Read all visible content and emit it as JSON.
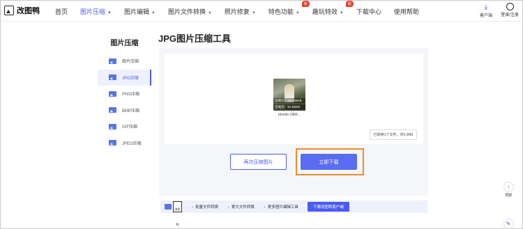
{
  "app": {
    "logo_text": "改图鸭"
  },
  "nav": {
    "items": [
      {
        "label": "首页",
        "chevron": false
      },
      {
        "label": "图片压缩",
        "chevron": true,
        "active": true
      },
      {
        "label": "图片编辑",
        "chevron": true
      },
      {
        "label": "图片文件转换",
        "chevron": true
      },
      {
        "label": "照片修复",
        "chevron": true
      },
      {
        "label": "特色功能",
        "chevron": true,
        "badge": "新"
      },
      {
        "label": "趣玩特效",
        "chevron": true,
        "badge": "新"
      },
      {
        "label": "下载中心",
        "chevron": false
      },
      {
        "label": "使用帮助",
        "chevron": false
      }
    ],
    "client_label": "客户端",
    "login_label": "登录/注册"
  },
  "sidebar": {
    "title": "图片压缩",
    "items": [
      {
        "label": "图片压缩"
      },
      {
        "label": "JPG压缩",
        "active": true
      },
      {
        "label": "PNG压缩"
      },
      {
        "label": "BMP压缩"
      },
      {
        "label": "GIF压缩"
      },
      {
        "label": "JPEG压缩"
      }
    ]
  },
  "main": {
    "title": "JPG图片压缩工具",
    "file": {
      "before": "压缩前：163.36KB",
      "after": "压缩后：61.66KB",
      "name": "blonde-1866..."
    },
    "status": "已转换1个文件，共0.06M",
    "again_button": "再次压缩图片",
    "download_button": "立即下载"
  },
  "bottombar": {
    "logo_label": "改图鸭",
    "items": [
      "批量文件转换",
      "更大文件转换",
      "更多图片编辑工具"
    ],
    "cta": "下载改图鸭客户端"
  },
  "float": {
    "top_label": "顶部",
    "feedback_label": "反馈"
  }
}
